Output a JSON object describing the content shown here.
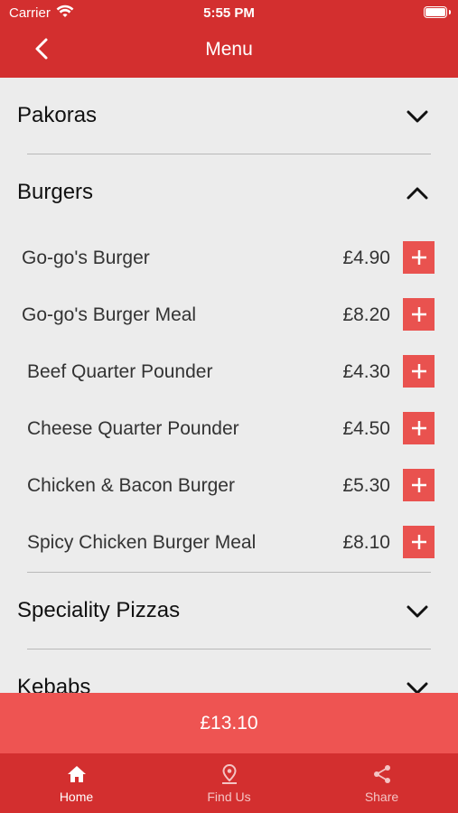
{
  "status_bar": {
    "carrier": "Carrier",
    "time": "5:55 PM"
  },
  "nav": {
    "title": "Menu"
  },
  "categories": [
    {
      "title": "Pakoras",
      "expanded": false
    },
    {
      "title": "Burgers",
      "expanded": true,
      "items": [
        {
          "name": "Go-go's Burger",
          "price": "£4.90"
        },
        {
          "name": "Go-go's Burger Meal",
          "price": "£8.20"
        },
        {
          "name": "Beef Quarter Pounder",
          "price": "£4.30"
        },
        {
          "name": "Cheese Quarter Pounder",
          "price": "£4.50"
        },
        {
          "name": "Chicken & Bacon Burger",
          "price": "£5.30"
        },
        {
          "name": "Spicy Chicken Burger Meal",
          "price": "£8.10"
        }
      ]
    },
    {
      "title": "Speciality Pizzas",
      "expanded": false
    },
    {
      "title": "Kebabs",
      "expanded": false
    }
  ],
  "total": "£13.10",
  "tabs": [
    {
      "label": "Home",
      "icon": "home-icon",
      "active": true
    },
    {
      "label": "Find Us",
      "icon": "location-pin-icon",
      "active": false
    },
    {
      "label": "Share",
      "icon": "share-icon",
      "active": false
    }
  ],
  "colors": {
    "primary": "#d32f2f",
    "accent": "#e9524f",
    "total_bar": "#ee5452",
    "background": "#ececec"
  }
}
